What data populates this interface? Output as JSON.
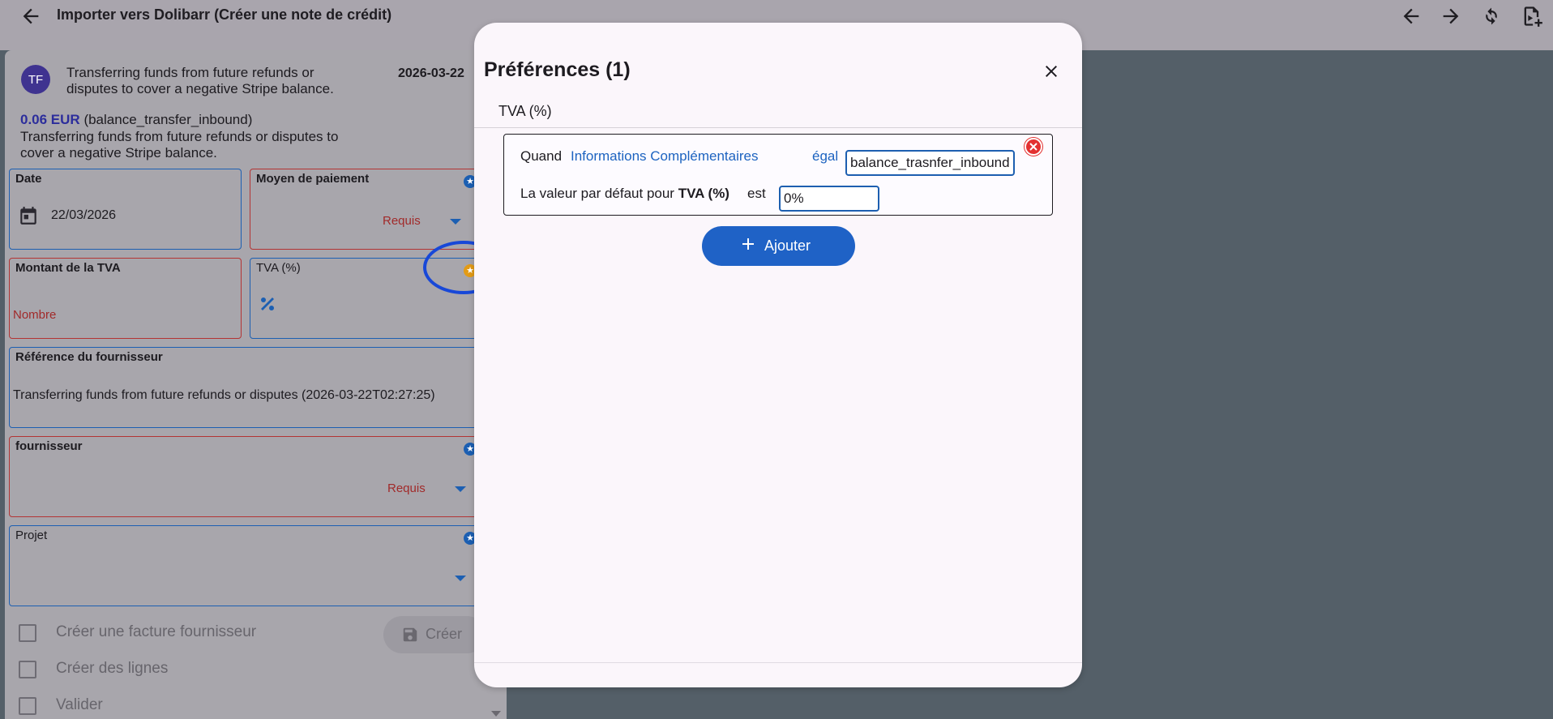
{
  "topbar": {
    "title": "Importer vers Dolibarr (Créer une note de crédit)",
    "icons": [
      "arrow-left-icon",
      "arrow-left-icon",
      "arrow-right-icon",
      "refresh-icon",
      "file-add-icon"
    ]
  },
  "card": {
    "avatar_initials": "TF",
    "header_text": "Transferring funds from future refunds or disputes to cover a negative Stripe balance.",
    "date": "2026-03-22",
    "amount": "0.06 EUR",
    "amount_type": "(balance_transfer_inbound)",
    "description": "Transferring funds from future refunds or disputes to cover a negative Stripe balance."
  },
  "form": {
    "date": {
      "label": "Date",
      "value": "22/03/2026"
    },
    "payment": {
      "label": "Moyen de paiement",
      "hint": "Requis"
    },
    "vat_amount": {
      "label": "Montant de la TVA",
      "hint": "Nombre"
    },
    "vat_rate": {
      "label": "TVA (%)"
    },
    "supplier_ref": {
      "label": "Référence du fournisseur",
      "value": "Transferring funds from future refunds or disputes (2026-03-22T02:27:25)"
    },
    "supplier": {
      "label": "fournisseur",
      "hint": "Requis"
    },
    "project": {
      "label": "Projet"
    },
    "checkboxes": [
      "Créer une facture fournisseur",
      "Créer des lignes",
      "Valider"
    ],
    "create_label": "Créer"
  },
  "dialog": {
    "title": "Préférences (1)",
    "subtitle": "TVA (%)",
    "rule": {
      "when": "Quand",
      "field": "Informations Complémentaires",
      "operator": "égal",
      "value": "balance_trasnfer_inbound",
      "default_prefix": "La valeur par défaut pour",
      "default_field": "TVA (%)",
      "is": "est",
      "default_value": "0%"
    },
    "add_label": "Ajouter"
  },
  "colors": {
    "accent": "#1f62c6",
    "required": "#b33434",
    "highlight": "#1848d8",
    "star_orange": "#e39b16"
  }
}
